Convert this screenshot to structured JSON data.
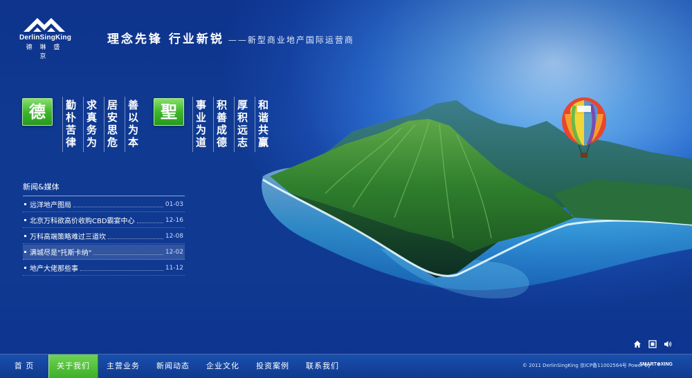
{
  "logo": {
    "name": "DerlinSingKing",
    "subtitle": "德 琳 盛 京"
  },
  "slogan": {
    "main": "理念先锋 行业新锐",
    "sub": "——新型商业地产国际运营商"
  },
  "values": {
    "seal_1": "德",
    "seal_2": "聖",
    "columns": [
      "勤朴苦律",
      "求真务为",
      "居安思危",
      "善以为本",
      "事业为道",
      "积善成德",
      "厚积远志",
      "和谐共赢"
    ]
  },
  "news": {
    "heading": "新闻&媒体",
    "items": [
      {
        "title": "远洋地产图局",
        "date": "01-03"
      },
      {
        "title": "北京万科欲高价收购CBD霸宴中心",
        "date": "12-16"
      },
      {
        "title": "万科高端策略难过三道坎",
        "date": "12-08"
      },
      {
        "title": "满城尽是\"托斯卡纳\"",
        "date": "12-02"
      },
      {
        "title": "地产大佬那些事",
        "date": "11-12"
      }
    ]
  },
  "nav": {
    "items": [
      "首 页",
      "关于我们",
      "主营业务",
      "新闻动态",
      "企业文化",
      "投资案例",
      "联系我们"
    ],
    "active_index": 1
  },
  "footer": {
    "copyright": "© 2011 DerlinSingKing  京ICP备11002564号  Power by",
    "brand": "SMART⊕XING"
  },
  "icons": {
    "home": "home-icon",
    "qr": "qr-code-icon",
    "sound": "speaker-icon"
  },
  "colors": {
    "accent_green": "#3fb52d",
    "background_blue": "#1747a8"
  }
}
